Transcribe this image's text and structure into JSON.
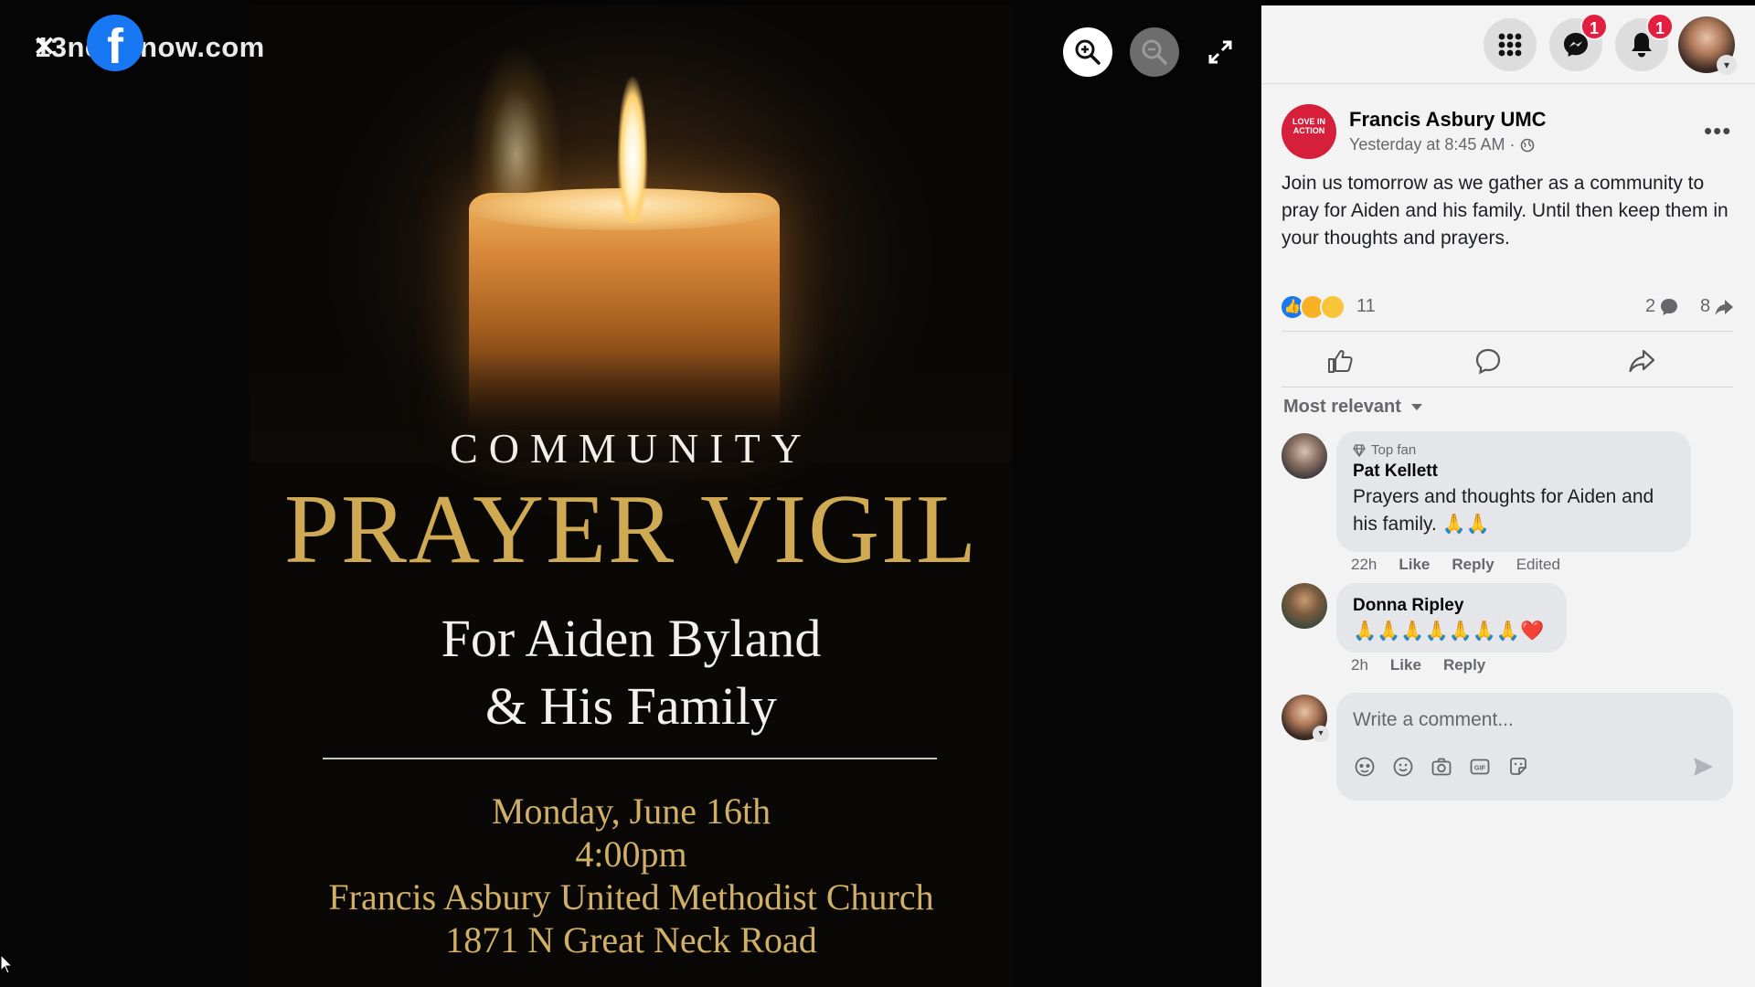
{
  "watermark": {
    "text": "13newsnow.com"
  },
  "poster": {
    "line1": "COMMUNITY",
    "line2": "PRAYER VIGIL",
    "line3a": "For Aiden Byland",
    "line3b": "& His Family",
    "date": "Monday, June 16th",
    "time": "4:00pm",
    "venue": "Francis Asbury United Methodist Church",
    "address": "1871 N Great Neck Road"
  },
  "topbar": {
    "messenger_badge": "1",
    "notifications_badge": "1"
  },
  "post": {
    "page_name": "Francis Asbury UMC",
    "avatar_text": "LOVE IN ACTION",
    "timestamp": "Yesterday at 8:45 AM ·",
    "more": "•••",
    "text": "Join us tomorrow as we gather as a community to pray for Aiden and his family. Until then keep them in your thoughts and prayers.",
    "reaction_count": "11",
    "comment_count": "2",
    "share_count": "8"
  },
  "comments": {
    "sort_label": "Most relevant",
    "items": [
      {
        "badge": "Top fan",
        "name": "Pat Kellett",
        "text": "Prayers and thoughts for Aiden and his family. 🙏🙏",
        "time": "22h",
        "like": "Like",
        "reply": "Reply",
        "edited": "Edited"
      },
      {
        "name": "Donna Ripley",
        "text": "🙏🙏🙏🙏🙏🙏🙏❤️",
        "time": "2h",
        "like": "Like",
        "reply": "Reply"
      }
    ]
  },
  "composer": {
    "placeholder": "Write a comment..."
  },
  "colors": {
    "brand": "#1877f2",
    "badge": "#e41e3f",
    "poster_gold": "#cfaa52"
  }
}
